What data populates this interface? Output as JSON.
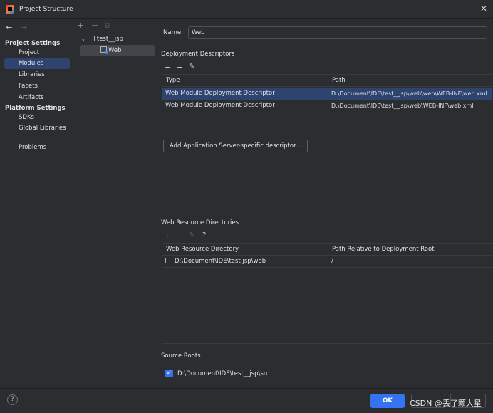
{
  "window": {
    "title": "Project Structure"
  },
  "nav": {
    "back": "←",
    "forward": "→",
    "project_settings": "Project Settings",
    "project_items": [
      "Project",
      "Modules",
      "Libraries",
      "Facets",
      "Artifacts"
    ],
    "platform_settings": "Platform Settings",
    "platform_items": [
      "SDKs",
      "Global Libraries"
    ],
    "problems": "Problems",
    "selected": "Modules"
  },
  "tree": {
    "tools": [
      "+",
      "−",
      "⧉"
    ],
    "root": "test__jsp",
    "child": "Web"
  },
  "main": {
    "name_label": "Name:",
    "name_value": "Web",
    "deployment": {
      "title": "Deployment Descriptors",
      "columns": [
        "Type",
        "Path"
      ],
      "rows": [
        {
          "type": "Web Module Deployment Descriptor",
          "path": "D:\\Document\\IDE\\test__jsp\\web\\web\\WEB-INF\\web.xml"
        },
        {
          "type": "Web Module Deployment Descriptor",
          "path": "D:\\Document\\IDE\\test__jsp\\web\\WEB-INF\\web.xml"
        }
      ],
      "add_button": "Add Application Server-specific descriptor..."
    },
    "resources": {
      "title": "Web Resource Directories",
      "columns": [
        "Web Resource Directory",
        "Path Relative to Deployment Root"
      ],
      "rows": [
        {
          "dir": "D:\\Document\\IDE\\test  jsp\\web",
          "rel": "/"
        }
      ]
    },
    "source_roots": {
      "title": "Source Roots",
      "item": "D:\\Document\\IDE\\test__jsp\\src",
      "checked": true
    }
  },
  "footer": {
    "help": "?",
    "ok": "OK",
    "watermark": "CSDN @丢了颗大星"
  },
  "colors": {
    "accent": "#3574f0",
    "selection": "#2e436e",
    "background": "#2b2d30"
  }
}
